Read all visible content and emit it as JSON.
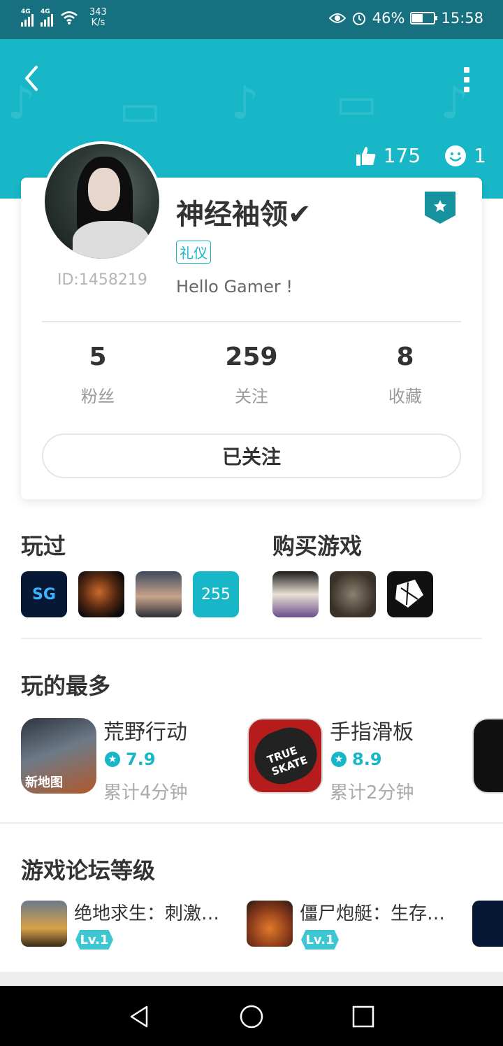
{
  "status_bar": {
    "net1": "4G",
    "net2": "4G",
    "speed_value": "343",
    "speed_unit": "K/s",
    "battery": "46%",
    "battery_level": 0.46,
    "time": "15:58"
  },
  "header": {
    "likes": "175",
    "visitors": "1"
  },
  "profile": {
    "username": "神经袖领✔",
    "tag": "礼仪",
    "id_text": "ID:1458219",
    "bio": "Hello Gamer !",
    "stats": [
      {
        "num": "5",
        "label": "粉丝"
      },
      {
        "num": "259",
        "label": "关注"
      },
      {
        "num": "8",
        "label": "收藏"
      }
    ],
    "follow_label": "已关注"
  },
  "played": {
    "title": "玩过",
    "more_count": "255"
  },
  "purchased": {
    "title": "购买游戏"
  },
  "most_played": {
    "title": "玩的最多",
    "items": [
      {
        "name": "荒野行动",
        "score": "7.9",
        "time": "累计4分钟",
        "badge": "新地图"
      },
      {
        "name": "手指滑板",
        "score": "8.9",
        "time": "累计2分钟",
        "badge": "TRUE SKATE"
      }
    ]
  },
  "forum": {
    "title": "游戏论坛等级",
    "items": [
      {
        "name": "绝地求生：刺激…",
        "level": "Lv.1"
      },
      {
        "name": "僵尸炮艇：生存…",
        "level": "Lv.1"
      }
    ]
  },
  "colors": {
    "accent": "#18b7c7",
    "status_bar": "#16707f"
  }
}
